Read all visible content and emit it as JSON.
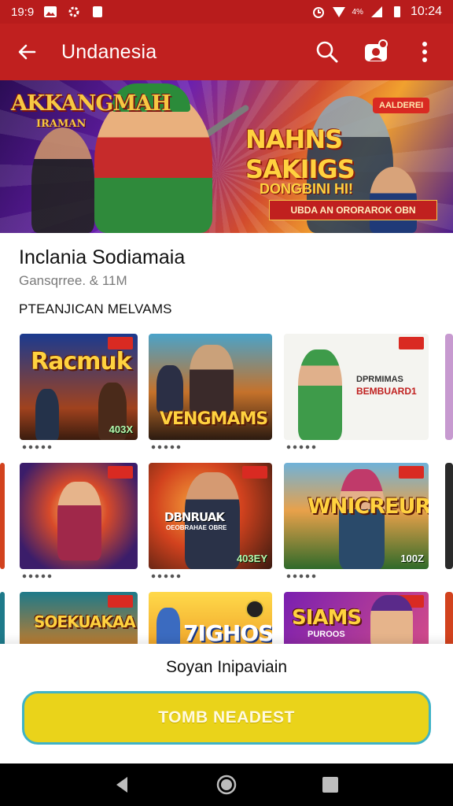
{
  "status_bar": {
    "time_left": "19:9",
    "time_right": "10:24",
    "battery_text": "4%"
  },
  "app_bar": {
    "title": "Undanesia",
    "icons": [
      "back-arrow-icon",
      "search-icon",
      "account-badge-icon",
      "more-vert-icon"
    ]
  },
  "banner": {
    "logo": "AKKANGMAH",
    "logo_sub": "IRAMAN",
    "badge": "AALDEREI",
    "headline": "NAHNS SAKIIGS",
    "sub_headline": "DONGBINI HI!",
    "strip": "UBDA AN ORORAROK OBN"
  },
  "app_info": {
    "title": "Inclania Sodiamaia",
    "meta": "Gansqrree. & 11M",
    "section_label": "PTEANJICAN MELVAMS"
  },
  "games": [
    {
      "name": "Racmuk",
      "score": "403X"
    },
    {
      "name": "VENGMAMS",
      "score": ""
    },
    {
      "name": "BEMBUARD1",
      "label_top": "DPRMIMAS",
      "score": ""
    },
    {
      "name": "",
      "score": ""
    },
    {
      "name": "DBNRUAK",
      "label_sub": "OEOBRAHAE OBRE",
      "score": "403EY"
    },
    {
      "name": "WNICREUR",
      "score": "100Z"
    },
    {
      "name": "SOEKUAKAA",
      "score": ""
    },
    {
      "name": "7IGHOS",
      "score": ""
    },
    {
      "name": "SIAMS",
      "label_sub": "PUROOS",
      "score": ""
    }
  ],
  "sheet": {
    "label": "Soyan Inipaviain",
    "cta_label": "TOMB NEADEST"
  },
  "colors": {
    "primary": "#c0201f",
    "cta": "#ead31a",
    "cta_border": "#3fb3c7"
  }
}
